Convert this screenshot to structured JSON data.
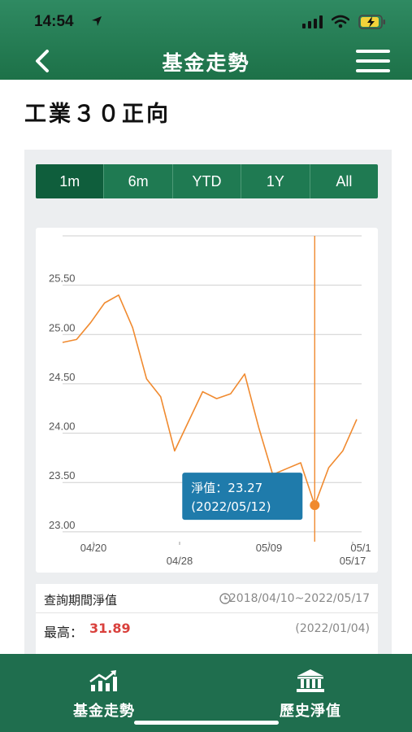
{
  "status_bar": {
    "time": "14:54"
  },
  "header": {
    "title": "基金走勢",
    "back_icon": "chevron-left-icon",
    "menu_icon": "hamburger-menu-icon"
  },
  "page": {
    "title": "工業３０正向"
  },
  "tabs": [
    {
      "label": "1m",
      "active": true
    },
    {
      "label": "6m",
      "active": false
    },
    {
      "label": "YTD",
      "active": false
    },
    {
      "label": "1Y",
      "active": false
    },
    {
      "label": "All",
      "active": false
    }
  ],
  "chart_data": {
    "type": "line",
    "y_ticks": [
      "25.50",
      "25.00",
      "24.50",
      "24.00",
      "23.50",
      "23.00"
    ],
    "ylim": [
      22.9,
      26.0
    ],
    "x_ticks_row1": [
      "04/20",
      "05/09",
      "05/1"
    ],
    "x_ticks_row2": [
      "04/28",
      "05/17"
    ],
    "series": [
      {
        "values": [
          24.92,
          24.95,
          25.12,
          25.32,
          25.4,
          25.07,
          24.55,
          24.37,
          23.82,
          24.12,
          24.42,
          24.35,
          24.4,
          24.6,
          24.06,
          23.58,
          23.64,
          23.7,
          23.27,
          23.65,
          23.82,
          24.14
        ]
      }
    ],
    "line_color": "#f08a2f",
    "grid": true,
    "tooltip": {
      "label": "淨值：23.27",
      "date": "(2022/05/12)"
    }
  },
  "info": {
    "period_label": "查詢期間淨值",
    "range": "2018/04/10~2022/05/17",
    "high_label": "最高：",
    "high_value": "31.89",
    "high_date": "(2022/01/04)"
  },
  "bottom_nav": {
    "trend_label": "基金走勢",
    "history_label": "歷史淨值"
  },
  "colors": {
    "brand_green": "#1f7a52",
    "accent_orange": "#f08a2f",
    "tooltip_blue": "#1f7bab",
    "high_red": "#d9403c"
  }
}
